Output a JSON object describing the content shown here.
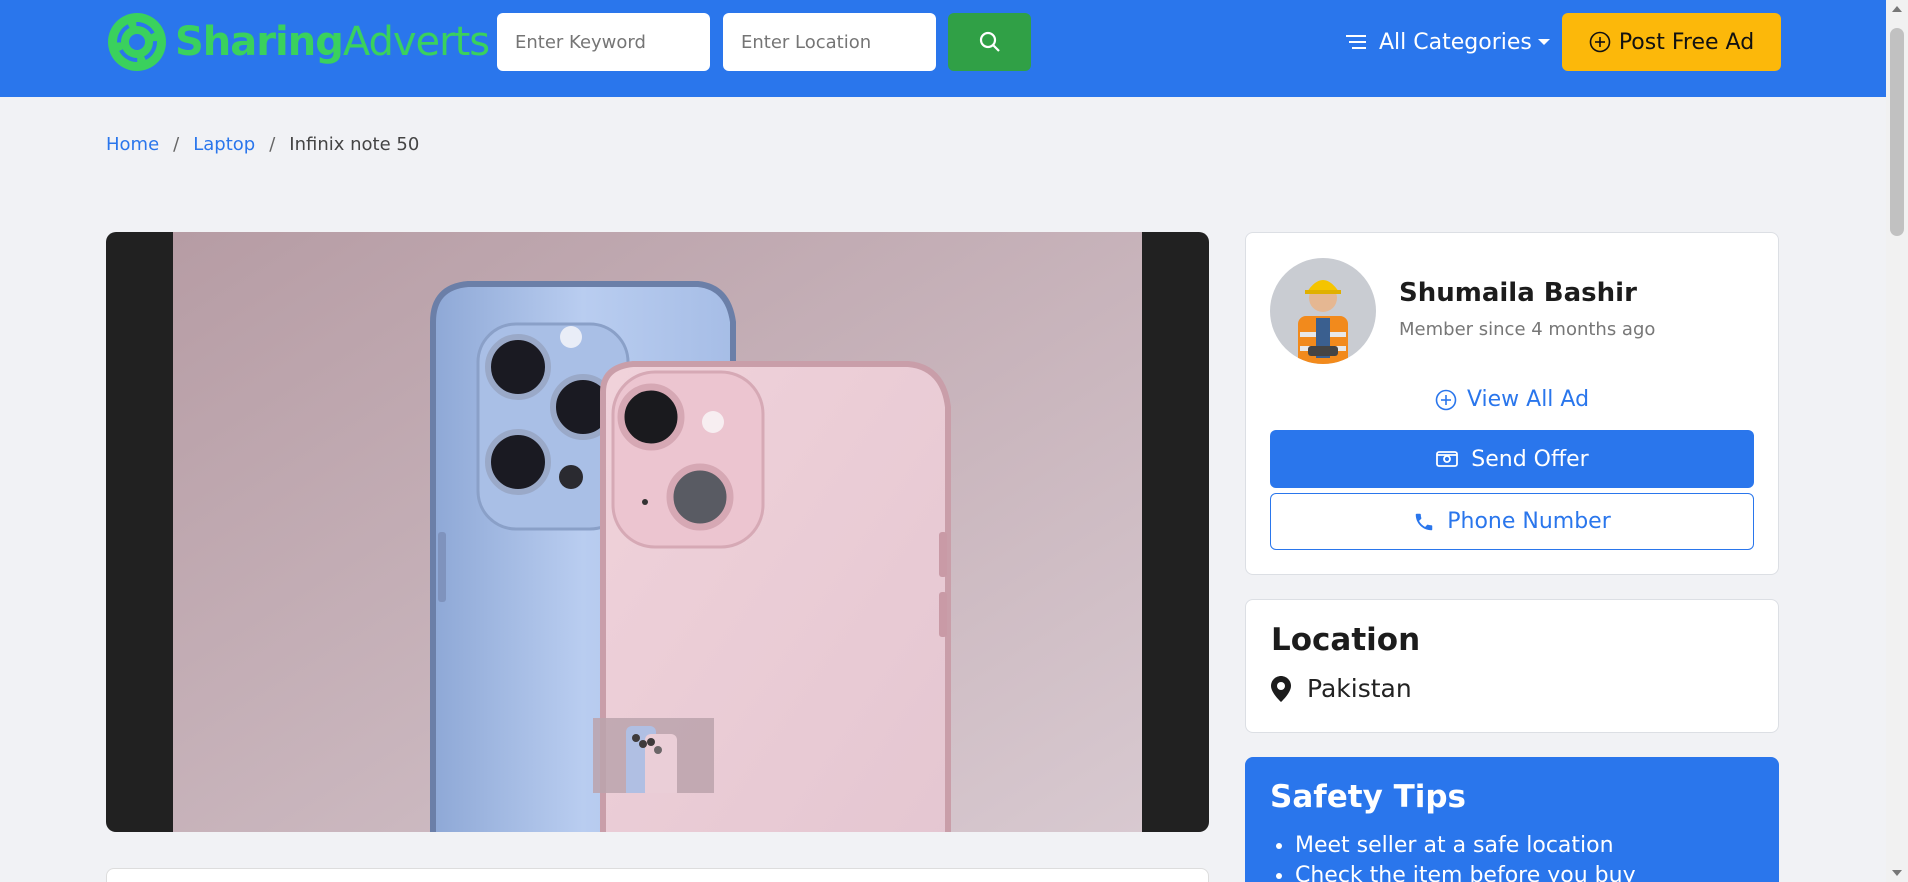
{
  "header": {
    "logo": {
      "bold": "Sharing",
      "light": "Adverts"
    },
    "keyword_placeholder": "Enter Keyword",
    "location_placeholder": "Enter Location",
    "categories_label": "All Categories",
    "post_label": "Post Free Ad",
    "colors": {
      "bar": "#2a76ec",
      "search": "#30a046",
      "post": "#fcb80a",
      "logo": "#3ad15d"
    }
  },
  "breadcrumb": {
    "items": [
      {
        "label": "Home"
      },
      {
        "label": "Laptop"
      }
    ],
    "current": "Infinix note 50",
    "separator": "/"
  },
  "gallery": {
    "main_image": "phone-photo",
    "thumbnail": "phone-thumbnail"
  },
  "seller": {
    "name": "Shumaila Bashir",
    "member_since": "Member since 4 months ago",
    "view_all_label": "View All Ad",
    "send_offer_label": "Send Offer",
    "phone_label": "Phone Number"
  },
  "location": {
    "title": "Location",
    "value": "Pakistan"
  },
  "safety": {
    "title": "Safety Tips",
    "tips": [
      "Meet seller at a safe location",
      "Check the item before you buy"
    ]
  }
}
